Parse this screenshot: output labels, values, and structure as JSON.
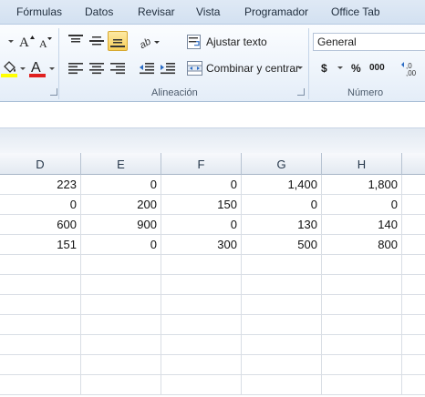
{
  "ribbon_tabs": [
    "Fórmulas",
    "Datos",
    "Revisar",
    "Vista",
    "Programador",
    "Office Tab"
  ],
  "alignment_group": {
    "label": "Alineación",
    "wrap_text_label": "Ajustar texto",
    "merge_center_label": "Combinar y centrar"
  },
  "number_group": {
    "label": "Número",
    "format_value": "General",
    "currency_symbol": "$",
    "percent_symbol": "%",
    "thousands_symbol": "000"
  },
  "grid": {
    "columns": [
      "D",
      "E",
      "F",
      "G",
      "H"
    ],
    "rows": [
      [
        "223",
        "0",
        "0",
        "1,400",
        "1,800"
      ],
      [
        "0",
        "200",
        "150",
        "0",
        "0"
      ],
      [
        "600",
        "900",
        "0",
        "130",
        "140"
      ],
      [
        "151",
        "0",
        "300",
        "500",
        "800"
      ],
      [
        "",
        "",
        "",
        "",
        ""
      ],
      [
        "",
        "",
        "",
        "",
        ""
      ],
      [
        "",
        "",
        "",
        "",
        ""
      ],
      [
        "",
        "",
        "",
        "",
        ""
      ],
      [
        "",
        "",
        "",
        "",
        ""
      ],
      [
        "",
        "",
        "",
        "",
        ""
      ],
      [
        "",
        "",
        "",
        "",
        ""
      ]
    ]
  },
  "colors": {
    "selected_button": "#f8cf58",
    "font_color_bar": "#e02020",
    "fill_color_bar": "#ffff00",
    "column_header_text": "#26374a"
  }
}
